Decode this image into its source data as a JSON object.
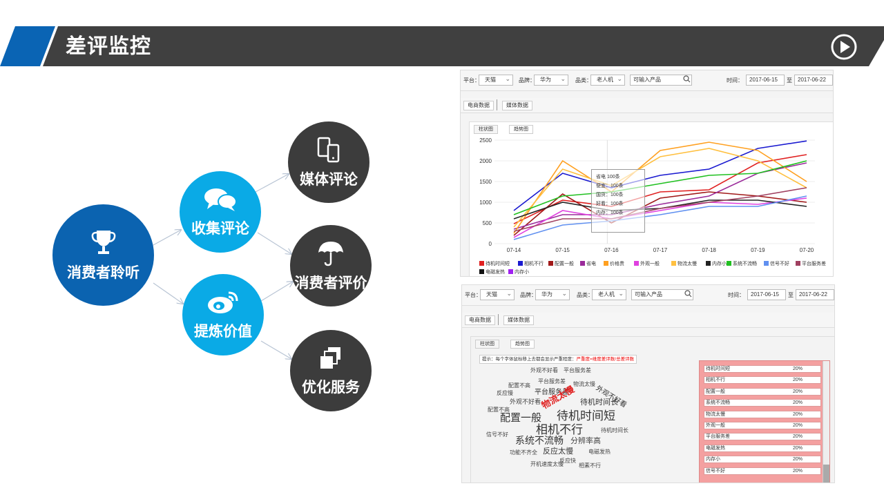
{
  "header": {
    "title": "差评监控",
    "colors": {
      "bar": "#404040",
      "accent": "#0a64b4"
    },
    "play_icon": "play-circle-icon"
  },
  "diagram": {
    "nodes": {
      "root": {
        "label": "消费者聆听",
        "icon": "trophy-icon",
        "color": "#0b63b0"
      },
      "collect": {
        "label": "收集评论",
        "icon": "chat-bubbles-icon",
        "color": "#0aaae6"
      },
      "refine": {
        "label": "提炼价值",
        "icon": "weibo-icon",
        "color": "#0aaae6"
      },
      "media": {
        "label": "媒体评论",
        "icon": "devices-icon",
        "color": "#3c3c3c"
      },
      "consumer": {
        "label": "消费者评价",
        "icon": "umbrella-icon",
        "color": "#3c3c3c"
      },
      "optimize": {
        "label": "优化服务",
        "icon": "layers-icon",
        "color": "#3c3c3c"
      }
    }
  },
  "filters_top": {
    "platform_label": "平台：",
    "platform_value": "天猫",
    "brand_label": "品牌：",
    "brand_value": "华为",
    "category_label": "品类：",
    "category_value": "老人机",
    "product_placeholder": "可输入产品",
    "time_label": "时间：",
    "date_from": "2017-06-15",
    "to_label": "至",
    "date_to": "2017-06-22",
    "tab_ecommerce": "电商数据",
    "tab_media": "媒体数据",
    "subtab_bar": "柱状图",
    "subtab_trend": "趋势图"
  },
  "tooltip": {
    "lines": [
      "省电   100条",
      "便宜：100条",
      "国货：100条",
      "好看：100条",
      "内存：100条"
    ]
  },
  "chart_data": {
    "type": "line",
    "x": [
      "07-14",
      "07-15",
      "07-16",
      "07-17",
      "07-18",
      "07-19",
      "07-20"
    ],
    "ylim": [
      0,
      2500
    ],
    "yticks": [
      0,
      500,
      1000,
      1500,
      2000,
      2500
    ],
    "grid": true,
    "legend_position": "bottom",
    "series": [
      {
        "name": "待机时间短",
        "color": "#e02020",
        "values": [
          480,
          1050,
          900,
          1250,
          1300,
          1950,
          2150
        ]
      },
      {
        "name": "相机不行",
        "color": "#1a1ad0",
        "values": [
          800,
          1700,
          1350,
          1650,
          1800,
          2300,
          2480
        ]
      },
      {
        "name": "配置一般",
        "color": "#a01818",
        "values": [
          200,
          1200,
          500,
          1100,
          1250,
          1150,
          1000
        ]
      },
      {
        "name": "省电",
        "color": "#9a2a9a",
        "values": [
          350,
          700,
          700,
          950,
          1150,
          1700,
          1950
        ]
      },
      {
        "name": "价格贵",
        "color": "#ffa020",
        "values": [
          250,
          2000,
          1250,
          2250,
          2450,
          2250,
          1500
        ]
      },
      {
        "name": "外观一般",
        "color": "#e040e0",
        "values": [
          150,
          800,
          600,
          800,
          1000,
          950,
          1100
        ]
      },
      {
        "name": "物流太慢",
        "color": "#ffc040",
        "values": [
          400,
          1800,
          1400,
          2100,
          2300,
          2000,
          1350
        ]
      },
      {
        "name": "内存小",
        "color": "#222222",
        "values": [
          600,
          1000,
          800,
          850,
          1050,
          1050,
          900
        ]
      },
      {
        "name": "系统不流畅",
        "color": "#20c020",
        "values": [
          700,
          1150,
          1250,
          1450,
          1650,
          1700,
          2000
        ]
      },
      {
        "name": "信号不好",
        "color": "#6090f0",
        "values": [
          100,
          450,
          550,
          700,
          900,
          900,
          1150
        ]
      },
      {
        "name": "平台服务差",
        "color": "#a04060",
        "values": [
          300,
          600,
          600,
          850,
          1000,
          1150,
          1350
        ]
      },
      {
        "name": "电磁发热",
        "color": "#111111",
        "values": []
      },
      {
        "name": "内存小",
        "color": "#a020f0",
        "values": []
      }
    ]
  },
  "cloud": {
    "hint_prefix": "提示：每个字体鼠标移上去都会显示严重程度：",
    "hint_formula": "严重度=维度差评数/总差评数",
    "words": [
      "外观不好看",
      "平台服务差",
      "平台服务差",
      "配置不高",
      "物流太慢",
      "外观不好看",
      "反应慢",
      "平台服务差",
      "待机时间长",
      "外观不好看",
      "物流太慢",
      "配置不高",
      "配置一般",
      "待机时间短",
      "相机不行",
      "待机时间长",
      "信号不好",
      "系统不流畅",
      "分辨率高",
      "功能不齐全",
      "反应太慢",
      "电磁发热",
      "开机速度太慢",
      "反应快",
      "相素不行"
    ]
  },
  "ranking": {
    "rows": [
      {
        "name": "待机时间短",
        "pct": "20%"
      },
      {
        "name": "相机不行",
        "pct": "20%"
      },
      {
        "name": "配置一般",
        "pct": "20%"
      },
      {
        "name": "系统不流畅",
        "pct": "20%"
      },
      {
        "name": "物流太慢",
        "pct": "20%"
      },
      {
        "name": "外观一般",
        "pct": "20%"
      },
      {
        "name": "平台服务差",
        "pct": "20%"
      },
      {
        "name": "电磁发热",
        "pct": "20%"
      },
      {
        "name": "内存小",
        "pct": "20%"
      },
      {
        "name": "信号不好",
        "pct": "20%"
      }
    ]
  }
}
